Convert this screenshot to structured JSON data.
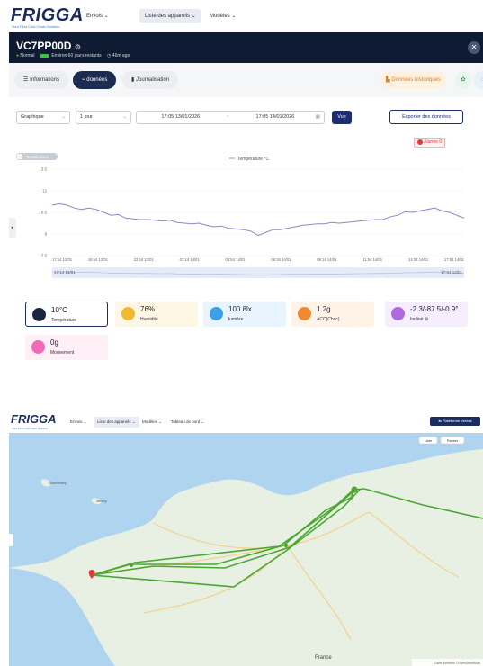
{
  "app": {
    "logo": "FRIGGA",
    "tagline": "Your First Cold Chain Solution"
  },
  "nav": {
    "items": [
      {
        "label": "Envois"
      },
      {
        "label": "Liste des appareils"
      },
      {
        "label": "Modèles"
      }
    ]
  },
  "device": {
    "name": "VC7PP00D",
    "status": "Normal",
    "battery": "Environ 60 jours restants",
    "last_update": "46m ago"
  },
  "tabs": {
    "informations": "Informations",
    "donnees": "données",
    "journalisation": "Journalisation",
    "historique": "Données historiques"
  },
  "toolbar": {
    "view_type": "Graphique",
    "period": "1 jour",
    "date_from": "17:05 13/01/2026",
    "date_sep": "~",
    "date_to": "17:05 14/01/2026",
    "view_button": "Vue",
    "export_button": "Exporter des données"
  },
  "alarm": {
    "label": "Alarme",
    "count": "0"
  },
  "chart_data": {
    "type": "line",
    "title": "",
    "legend": "Température °C",
    "toggle_label": "Température",
    "y_ticks": [
      "13.5",
      "12",
      "10.5",
      "9",
      "7.5"
    ],
    "ylim": [
      7.5,
      13.5
    ],
    "x_ticks": [
      "17:14 13/01",
      "19:54 13/01",
      "22:34 13/01",
      "01:14 14/01",
      "03:54 14/01",
      "06:34 14/01",
      "09:14 14/01",
      "11:54 14/01",
      "14:34 14/01",
      "17:04 14/01"
    ],
    "slider_start": "17:14 13/01",
    "slider_end": "17:04 14/01",
    "series": [
      {
        "values": [
          11.0,
          11.1,
          11.0,
          10.8,
          10.7,
          10.8,
          10.7,
          10.5,
          10.3,
          10.35,
          10.1,
          10.05,
          10.0,
          10.0,
          9.95,
          9.9,
          9.95,
          9.8,
          9.75,
          9.7,
          9.75,
          9.6,
          9.5,
          9.55,
          9.4,
          9.35,
          9.3,
          9.2,
          8.9,
          9.1,
          9.3,
          9.3,
          9.4,
          9.5,
          9.6,
          9.65,
          9.7,
          9.7,
          9.8,
          9.75,
          9.8,
          9.85,
          9.9,
          9.95,
          10.0,
          10.0,
          10.2,
          10.3,
          10.55,
          10.5,
          10.6,
          10.7,
          10.8,
          10.6,
          10.5,
          10.3,
          10.1
        ]
      }
    ]
  },
  "cards": [
    {
      "value": "10°C",
      "label": "Température",
      "color": "#1b2540",
      "bg": "#ffffff"
    },
    {
      "value": "76%",
      "label": "Humidité",
      "color": "#f4b730",
      "bg": "#fff7e6"
    },
    {
      "value": "100.8lx",
      "label": "lumière",
      "color": "#3aa0e8",
      "bg": "#e8f4ff"
    },
    {
      "value": "1.2g",
      "label": "ACC(Choc)",
      "color": "#f08a30",
      "bg": "#fff2e6"
    },
    {
      "value": "-2.3/-87.5/-0.9°",
      "label": "Incliné",
      "color": "#b06ae0",
      "bg": "#f6eefe"
    },
    {
      "value": "0g",
      "label": "Mouvement",
      "color": "#f06ab8",
      "bg": "#fff0f7"
    }
  ],
  "bottom_nav": {
    "items": [
      {
        "label": "Envois"
      },
      {
        "label": "Liste des appareils"
      },
      {
        "label": "Modèles"
      },
      {
        "label": "Tableau de bord"
      }
    ],
    "action_button": "Plateforme Ventes"
  },
  "map": {
    "list_button": "Liste",
    "filter_button": "Passer",
    "city_labels": [
      "Guernesey",
      "Jersey",
      "France"
    ],
    "attribution": "Carte données ©OpenStreetMap"
  }
}
